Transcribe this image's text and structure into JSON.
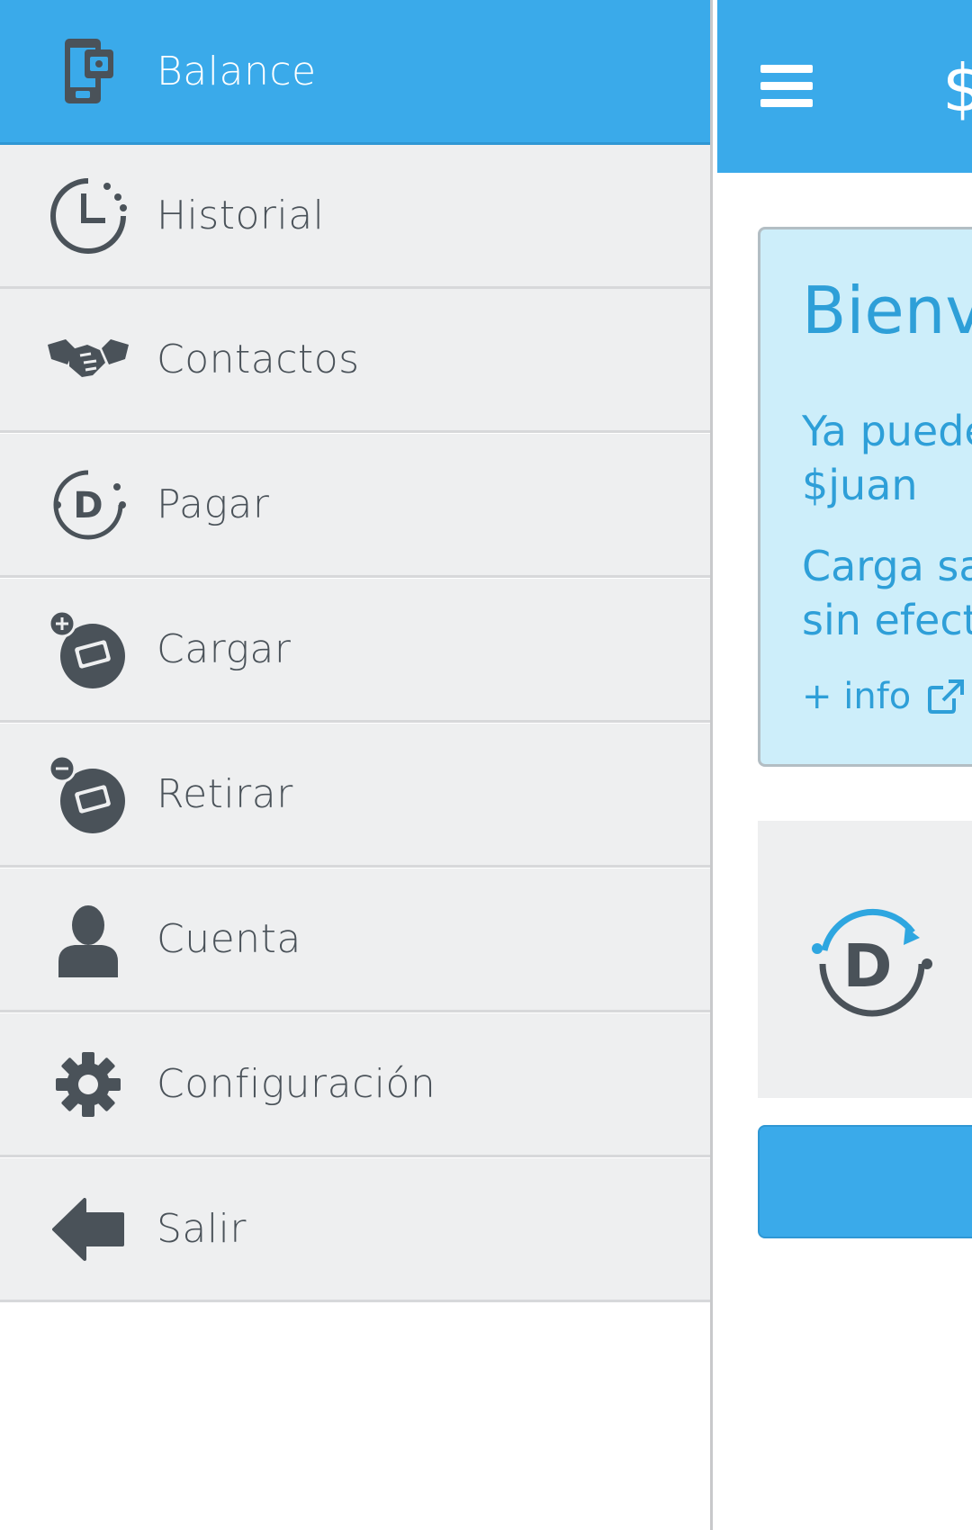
{
  "drawer": {
    "items": [
      {
        "label": "Balance",
        "icon": "wallet-phone-icon",
        "active": true
      },
      {
        "label": "Historial",
        "icon": "history-clock-icon"
      },
      {
        "label": "Contactos",
        "icon": "handshake-icon"
      },
      {
        "label": "Pagar",
        "icon": "pay-d-icon"
      },
      {
        "label": "Cargar",
        "icon": "cash-plus-icon"
      },
      {
        "label": "Retirar",
        "icon": "cash-minus-icon"
      },
      {
        "label": "Cuenta",
        "icon": "user-icon"
      },
      {
        "label": "Configuración",
        "icon": "gear-icon"
      },
      {
        "label": "Salir",
        "icon": "arrow-left-icon"
      }
    ]
  },
  "header": {
    "title": "$"
  },
  "welcome": {
    "title": "Bienve",
    "line1": "Ya puede",
    "line2": "$juan",
    "line3": "Carga sal",
    "line4": "sin efecti",
    "link": "+ info"
  },
  "colors": {
    "accent": "#3aaaea",
    "drawer_bg": "#eeeff0",
    "icon": "#5a6168",
    "welcome_bg": "#cdeefa",
    "welcome_text": "#2e9fd8"
  }
}
